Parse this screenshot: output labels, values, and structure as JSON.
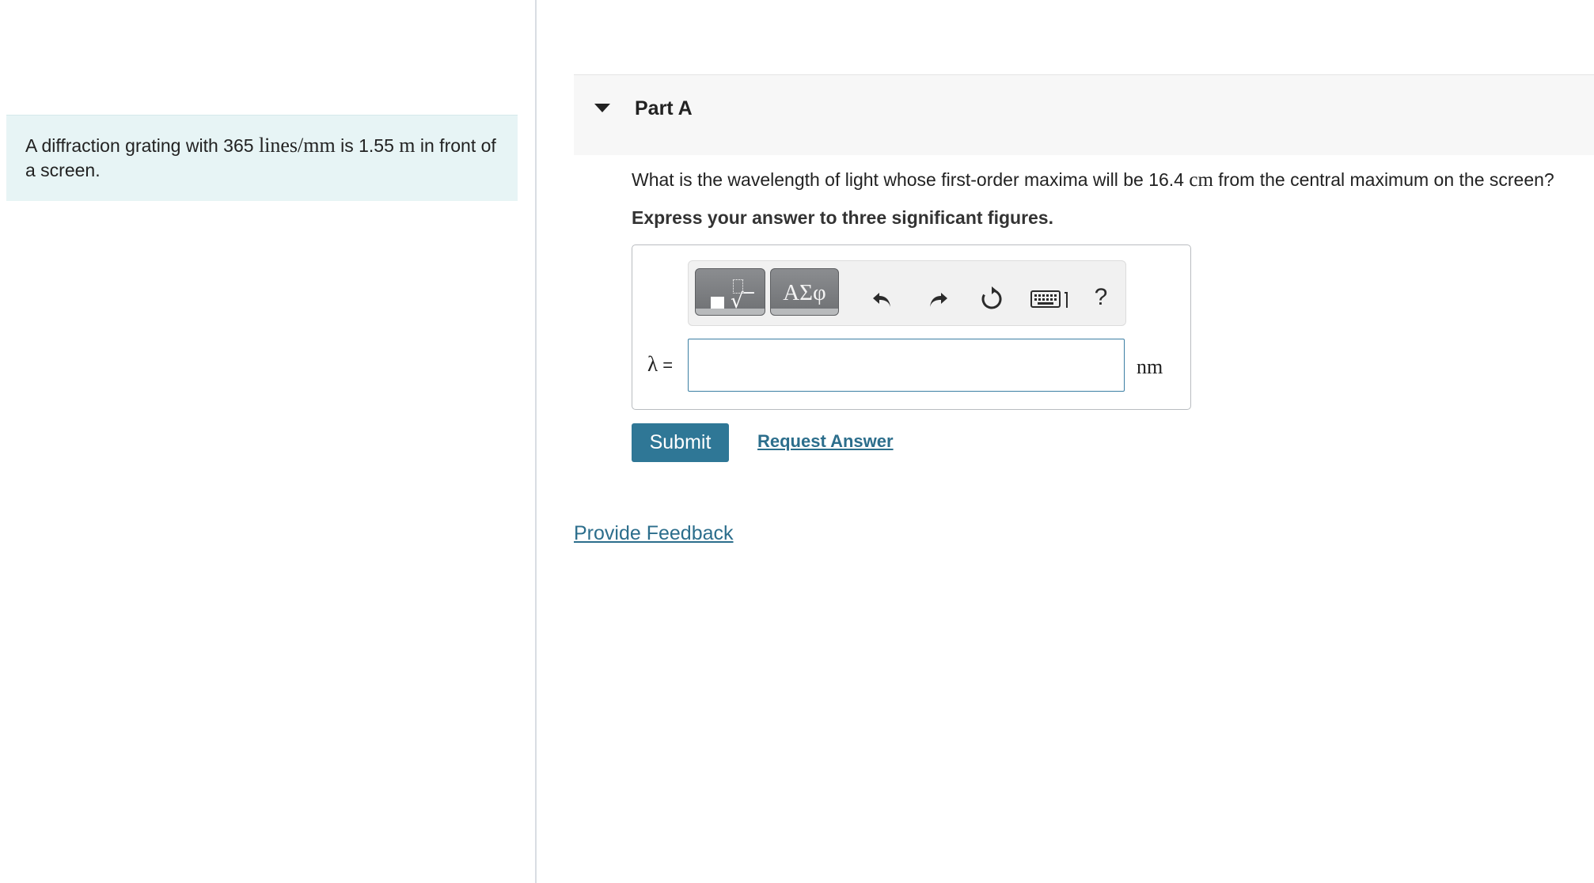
{
  "problem": {
    "intro_text_1": "A diffraction grating with 365 ",
    "intro_unit_1": "lines/mm",
    "intro_text_2": " is 1.55 ",
    "intro_unit_2": "m",
    "intro_text_3": " in front of a screen."
  },
  "part": {
    "title": "Part A",
    "question_1": "What is the wavelength of light whose first-order maxima will be 16.4 ",
    "question_unit": "cm",
    "question_2": " from the central maximum on the screen?",
    "instruction": "Express your answer to three significant figures."
  },
  "toolbar": {
    "greek_label": "ΑΣφ",
    "help_label": "?"
  },
  "answer": {
    "variable": "λ",
    "equals": " =",
    "value": "",
    "unit": "nm"
  },
  "actions": {
    "submit_label": "Submit",
    "request_answer_label": "Request Answer",
    "feedback_label": "Provide Feedback"
  },
  "colors": {
    "intro_background": "#e7f4f5",
    "submit_background": "#2f7796",
    "link": "#2c6e8c",
    "input_border": "#3b7fa3"
  }
}
